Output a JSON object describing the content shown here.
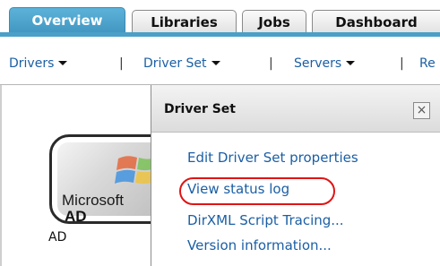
{
  "tabs": [
    {
      "label": "Overview",
      "active": true
    },
    {
      "label": "Libraries",
      "active": false
    },
    {
      "label": "Jobs",
      "active": false
    },
    {
      "label": "Dashboard",
      "active": false
    }
  ],
  "menubar": {
    "items": [
      {
        "label": "Drivers",
        "has_dropdown": true
      },
      {
        "label": "Driver Set",
        "has_dropdown": true
      },
      {
        "label": "Servers",
        "has_dropdown": true
      },
      {
        "label": "Re",
        "has_dropdown": false
      }
    ],
    "separator": "|"
  },
  "driver": {
    "logo_text": "Microsoft",
    "logo_abbr": "AD",
    "label": "AD",
    "icon": "windows-logo-icon"
  },
  "popup": {
    "title": "Driver Set",
    "close_icon": "close-icon",
    "close_glyph": "×",
    "items": [
      {
        "label": "Edit Driver Set properties",
        "highlighted": false
      },
      {
        "label": "View status log",
        "highlighted": true
      },
      {
        "label": "DirXML Script Tracing...",
        "highlighted": false
      },
      {
        "label": "Version information...",
        "highlighted": false
      }
    ]
  },
  "colors": {
    "tab_active": "#4aa0c8",
    "link": "#1b5fa5",
    "highlight_ring": "#e01414"
  }
}
